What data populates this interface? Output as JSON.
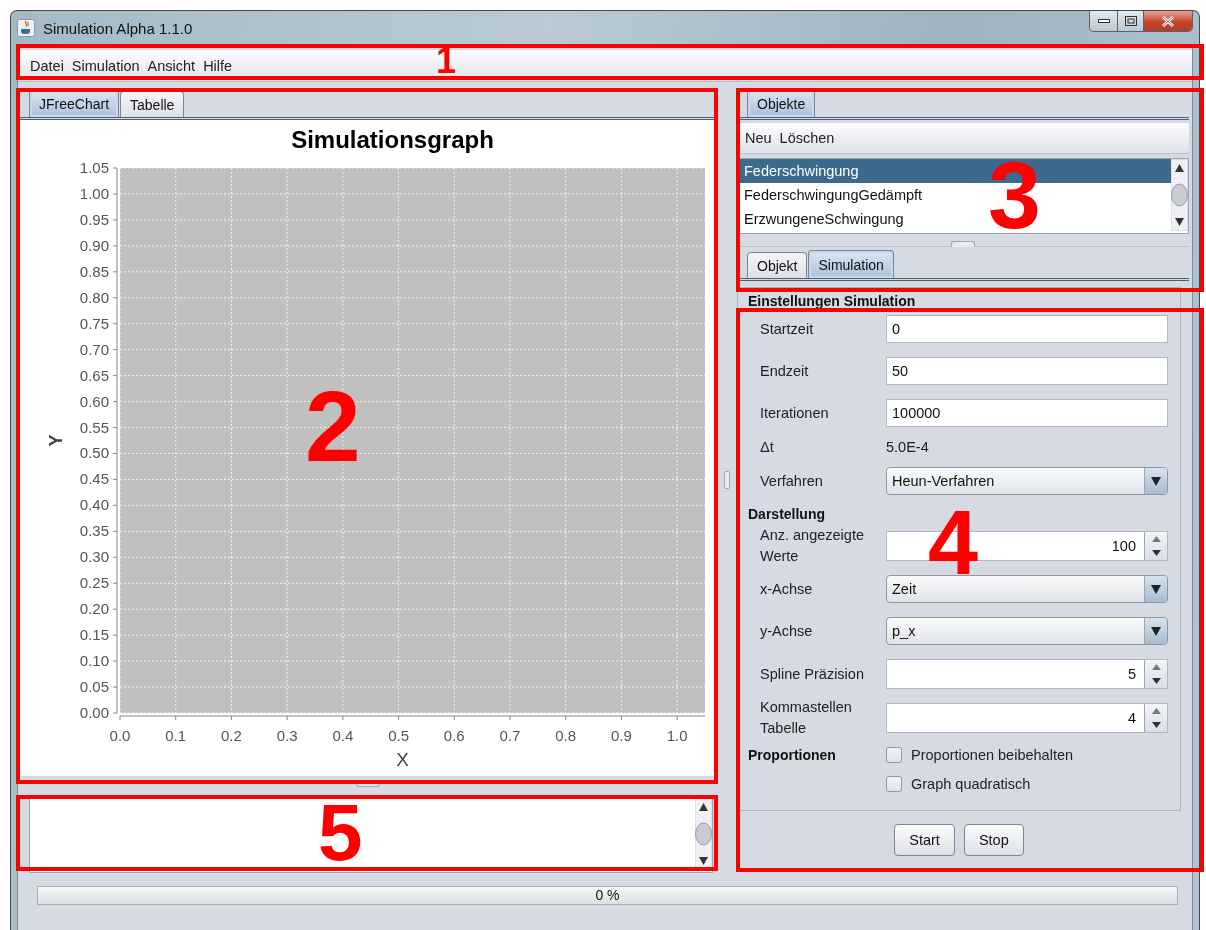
{
  "window": {
    "title": "Simulation Alpha 1.1.0"
  },
  "menu": [
    "Datei",
    "Simulation",
    "Ansicht",
    "Hilfe"
  ],
  "chart_tabs": [
    {
      "label": "JFreeChart",
      "selected": true
    },
    {
      "label": "Tabelle",
      "selected": false
    }
  ],
  "chart": {
    "chart_data": {
      "type": "line",
      "grid": true,
      "title": "Simulationsgraph",
      "xlabel": "X",
      "ylabel": "Y",
      "xlim": [
        0,
        1.05
      ],
      "ylim": [
        0,
        1.05
      ],
      "xticks": [
        {
          "value": 0,
          "label": "0.0"
        },
        {
          "value": 0.1,
          "label": "0.1"
        },
        {
          "value": 0.2,
          "label": "0.2"
        },
        {
          "value": 0.3,
          "label": "0.3"
        },
        {
          "value": 0.4,
          "label": "0.4"
        },
        {
          "value": 0.5,
          "label": "0.5"
        },
        {
          "value": 0.6,
          "label": "0.6"
        },
        {
          "value": 0.7,
          "label": "0.7"
        },
        {
          "value": 0.8,
          "label": "0.8"
        },
        {
          "value": 0.9,
          "label": "0.9"
        },
        {
          "value": 1,
          "label": "1.0"
        }
      ],
      "yticks": [
        {
          "value": 0,
          "label": "0.00"
        },
        {
          "value": 0.05,
          "label": "0.05"
        },
        {
          "value": 0.1,
          "label": "0.10"
        },
        {
          "value": 0.15,
          "label": "0.15"
        },
        {
          "value": 0.2,
          "label": "0.20"
        },
        {
          "value": 0.25,
          "label": "0.25"
        },
        {
          "value": 0.3,
          "label": "0.30"
        },
        {
          "value": 0.35,
          "label": "0.35"
        },
        {
          "value": 0.4,
          "label": "0.40"
        },
        {
          "value": 0.45,
          "label": "0.45"
        },
        {
          "value": 0.5,
          "label": "0.50"
        },
        {
          "value": 0.55,
          "label": "0.55"
        },
        {
          "value": 0.6,
          "label": "0.60"
        },
        {
          "value": 0.65,
          "label": "0.65"
        },
        {
          "value": 0.7,
          "label": "0.70"
        },
        {
          "value": 0.75,
          "label": "0.75"
        },
        {
          "value": 0.8,
          "label": "0.80"
        },
        {
          "value": 0.85,
          "label": "0.85"
        },
        {
          "value": 0.9,
          "label": "0.90"
        },
        {
          "value": 0.95,
          "label": "0.95"
        },
        {
          "value": 1,
          "label": "1.00"
        },
        {
          "value": 1.05,
          "label": "1.05"
        }
      ]
    }
  },
  "objects_tabs": [
    {
      "label": "Objekte",
      "selected": true
    }
  ],
  "objects_toolbar": [
    "Neu",
    "Löschen"
  ],
  "objects_list": [
    {
      "label": "Federschwingung",
      "selected": true
    },
    {
      "label": "FederschwingungGedämpft",
      "selected": false
    },
    {
      "label": "ErzwungeneSchwingung",
      "selected": false
    }
  ],
  "detail_tabs": [
    {
      "label": "Objekt",
      "selected": false
    },
    {
      "label": "Simulation",
      "selected": true
    }
  ],
  "settings": {
    "heading": "Einstellungen Simulation",
    "rows": [
      {
        "kind": "text",
        "label": "Startzeit",
        "value": "0"
      },
      {
        "kind": "text",
        "label": "Endzeit",
        "value": "50"
      },
      {
        "kind": "text",
        "label": "Iterationen",
        "value": "100000"
      },
      {
        "kind": "readout",
        "label": "Δt",
        "value": "5.0E-4"
      },
      {
        "kind": "combo",
        "label": "Verfahren",
        "value": "Heun-Verfahren"
      },
      {
        "kind": "section",
        "label": "Darstellung"
      },
      {
        "kind": "spinner",
        "label": "Anz. angezeigte Werte",
        "value": "100"
      },
      {
        "kind": "combo",
        "label": "x-Achse",
        "value": "Zeit"
      },
      {
        "kind": "combo",
        "label": "y-Achse",
        "value": "p_x"
      },
      {
        "kind": "spinner",
        "label": "Spline Präzision",
        "value": "5"
      },
      {
        "kind": "spinner",
        "label": "Kommastellen Tabelle",
        "value": "4"
      },
      {
        "kind": "checkbox",
        "group_label": "Proportionen",
        "label": "Proportionen beibehalten",
        "checked": false
      },
      {
        "kind": "checkbox",
        "label": "Graph quadratisch",
        "checked": false
      }
    ]
  },
  "buttons": [
    "Start",
    "Stop"
  ],
  "progress": {
    "level": 0,
    "reading": "0 %"
  },
  "annotations": [
    {
      "label": "1"
    },
    {
      "label": "2"
    },
    {
      "label": "3"
    },
    {
      "label": "4"
    },
    {
      "label": "5"
    }
  ]
}
